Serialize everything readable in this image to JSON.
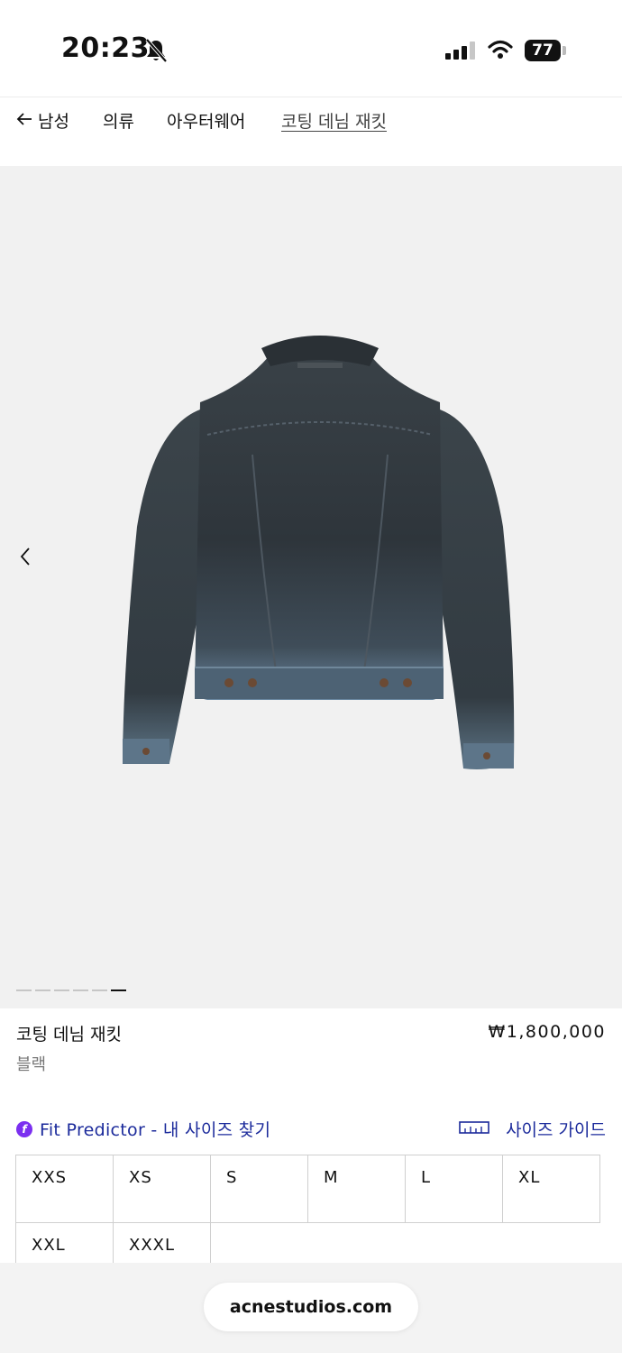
{
  "status_bar": {
    "time": "20:23",
    "battery": "77"
  },
  "breadcrumb": {
    "items": [
      {
        "label": "남성"
      },
      {
        "label": "의류"
      },
      {
        "label": "아우터웨어"
      },
      {
        "label": "코팅 데님 재킷"
      }
    ]
  },
  "gallery": {
    "slide_count": 6,
    "active_index": 5
  },
  "product": {
    "name": "코팅 데님 재킷",
    "price": "₩1,800,000",
    "color": "블랙"
  },
  "fit_predictor": {
    "label": "Fit Predictor - 내 사이즈 찾기"
  },
  "size_guide": {
    "label": "사이즈 가이드"
  },
  "sizes": [
    {
      "label": "XXS"
    },
    {
      "label": "XS"
    },
    {
      "label": "S"
    },
    {
      "label": "M"
    },
    {
      "label": "L"
    },
    {
      "label": "XL"
    },
    {
      "label": "XXL"
    },
    {
      "label": "XXXL"
    }
  ],
  "browser": {
    "url": "acnestudios.com"
  },
  "colors": {
    "link_blue": "#1b2a9b",
    "fit_purple": "#7b2ff0",
    "gallery_bg": "#f1f1f1"
  }
}
